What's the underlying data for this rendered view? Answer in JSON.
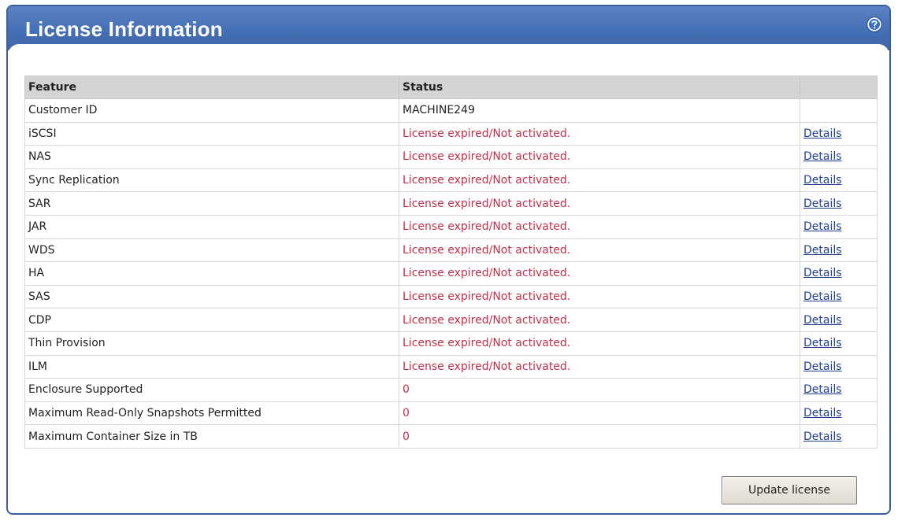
{
  "panel": {
    "title": "License Information",
    "help_icon": "help-icon"
  },
  "table": {
    "headers": {
      "feature": "Feature",
      "status": "Status",
      "action": ""
    },
    "rows": [
      {
        "feature": "Customer ID",
        "status": "MACHINE249",
        "status_color": "black",
        "link": ""
      },
      {
        "feature": "iSCSI",
        "status": "License expired/Not activated.",
        "status_color": "red",
        "link": "Details"
      },
      {
        "feature": "NAS",
        "status": "License expired/Not activated.",
        "status_color": "red",
        "link": "Details"
      },
      {
        "feature": "Sync Replication",
        "status": "License expired/Not activated.",
        "status_color": "red",
        "link": "Details"
      },
      {
        "feature": "SAR",
        "status": "License expired/Not activated.",
        "status_color": "red",
        "link": "Details"
      },
      {
        "feature": "JAR",
        "status": "License expired/Not activated.",
        "status_color": "red",
        "link": "Details"
      },
      {
        "feature": "WDS",
        "status": "License expired/Not activated.",
        "status_color": "red",
        "link": "Details"
      },
      {
        "feature": "HA",
        "status": "License expired/Not activated.",
        "status_color": "red",
        "link": "Details"
      },
      {
        "feature": "SAS",
        "status": "License expired/Not activated.",
        "status_color": "red",
        "link": "Details"
      },
      {
        "feature": "CDP",
        "status": "License expired/Not activated.",
        "status_color": "red",
        "link": "Details"
      },
      {
        "feature": "Thin Provision",
        "status": "License expired/Not activated.",
        "status_color": "red",
        "link": "Details"
      },
      {
        "feature": "ILM",
        "status": "License expired/Not activated.",
        "status_color": "red",
        "link": "Details"
      },
      {
        "feature": "Enclosure Supported",
        "status": "0",
        "status_color": "red",
        "link": "Details"
      },
      {
        "feature": "Maximum Read-Only Snapshots Permitted",
        "status": "0",
        "status_color": "red",
        "link": "Details"
      },
      {
        "feature": "Maximum Container Size in TB",
        "status": "0",
        "status_color": "red",
        "link": "Details"
      }
    ]
  },
  "actions": {
    "update_label": "Update license"
  },
  "colors": {
    "header_blue": "#4570b5",
    "status_red": "#c0304a",
    "link_blue": "#1f3f8c"
  }
}
